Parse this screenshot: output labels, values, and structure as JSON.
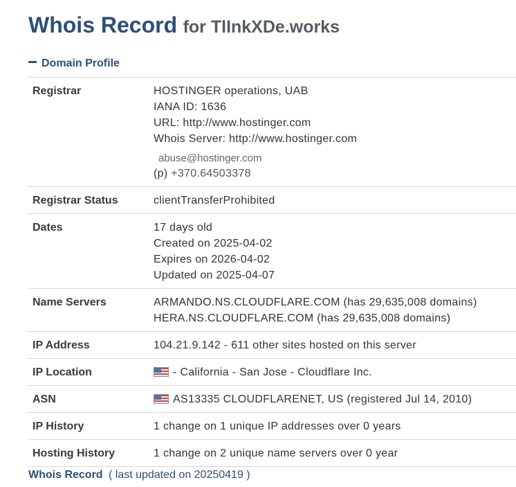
{
  "header": {
    "title": "Whois Record",
    "subtitle": "for TlInkXDe.works"
  },
  "section": {
    "toggle_icon": "minus-icon",
    "label": "Domain Profile"
  },
  "rows": {
    "registrar": {
      "label": "Registrar",
      "name": "HOSTINGER operations, UAB",
      "iana": "IANA ID: 1636",
      "url": "URL: http://www.hostinger.com",
      "whois_server": "Whois Server: http://www.hostinger.com",
      "email": "abuse@hostinger.com",
      "phone_prefix": "(p)",
      "phone": "+370.64503378"
    },
    "status": {
      "label": "Registrar Status",
      "value": "clientTransferProhibited"
    },
    "dates": {
      "label": "Dates",
      "age": "17 days old",
      "created": "Created on 2025-04-02",
      "expires": "Expires on 2026-04-02",
      "updated": "Updated on 2025-04-07"
    },
    "name_servers": {
      "label": "Name Servers",
      "ns1": "ARMANDO.NS.CLOUDFLARE.COM (has 29,635,008 domains)",
      "ns2": "HERA.NS.CLOUDFLARE.COM (has 29,635,008 domains)"
    },
    "ip_address": {
      "label": "IP Address",
      "value": "104.21.9.142 - 611 other sites hosted on this server"
    },
    "ip_location": {
      "label": "IP Location",
      "flag_icon": "us-flag-icon",
      "value": "- California - San Jose - Cloudflare Inc."
    },
    "asn": {
      "label": "ASN",
      "flag_icon": "us-flag-icon",
      "value": "AS13335 CLOUDFLARENET, US (registered Jul 14, 2010)"
    },
    "ip_history": {
      "label": "IP History",
      "value": "1 change on 1 unique IP addresses over 0 years"
    },
    "hosting_history": {
      "label": "Hosting History",
      "value": "1 change on 2 unique name servers over 0 year"
    }
  },
  "footer": {
    "title": "Whois Record",
    "note": "( last updated on 20250419 )"
  },
  "colors": {
    "heading": "#2d4f78",
    "subtitle": "#555b63",
    "text": "#333333",
    "divider": "#d6d6d6"
  }
}
